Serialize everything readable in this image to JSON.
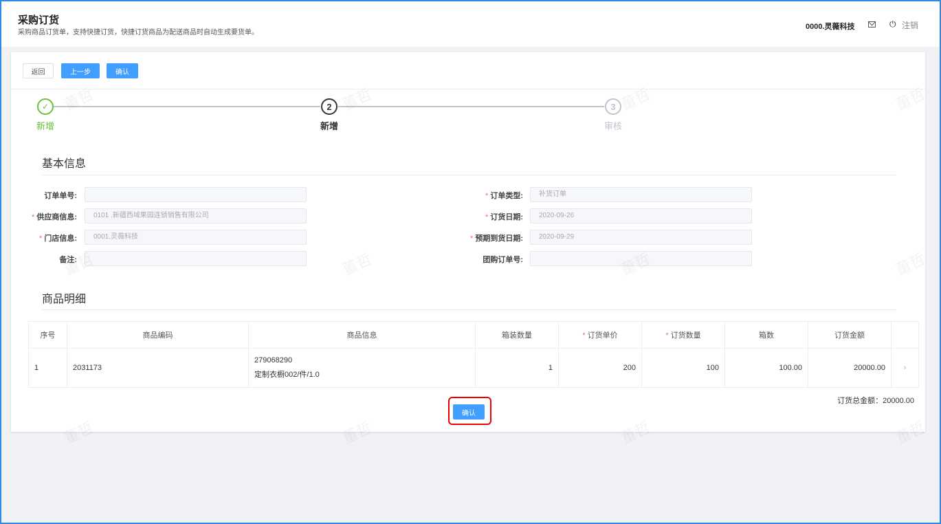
{
  "header": {
    "title": "采购订货",
    "subtitle": "采购商品订货单，支持快捷订货，快捷订货商品为配送商品时自动生成要货单。",
    "user": "0000.灵薇科技",
    "logout": "注销"
  },
  "toolbar": {
    "back": "返回",
    "prev": "上一步",
    "confirm": "确认"
  },
  "steps": [
    {
      "num": "✓",
      "label": "新增"
    },
    {
      "num": "2",
      "label": "新增"
    },
    {
      "num": "3",
      "label": "审核"
    }
  ],
  "basic": {
    "title": "基本信息",
    "order_no_label": "订单单号:",
    "order_no": "",
    "supplier_label": "供应商信息:",
    "supplier": "0101 .新疆西域果园连锁销售有限公司",
    "store_label": "门店信息:",
    "store": "0001.灵薇科技",
    "remark_label": "备注:",
    "remark": "",
    "type_label": "订单类型:",
    "type": "补货订单",
    "date_label": "订货日期:",
    "date": "2020-09-26",
    "expect_label": "预期到货日期:",
    "expect": "2020-09-29",
    "group_label": "团购订单号:",
    "group": ""
  },
  "detail": {
    "title": "商品明细",
    "columns": [
      "序号",
      "商品编码",
      "商品信息",
      "箱装数量",
      "订货单价",
      "订货数量",
      "箱数",
      "订货金额"
    ],
    "rows": [
      {
        "idx": "1",
        "code": "2031173",
        "info1": "279068290",
        "info2": "定制衣橱002/件/1.0",
        "pack": "1",
        "price": "200",
        "qty": "100",
        "boxes": "100.00",
        "amount": "20000.00"
      }
    ],
    "total": "订货总金额：20000.00"
  },
  "confirm_bottom": "确认",
  "watermark": "董哲",
  "colors": {
    "primary": "#409eff",
    "success": "#67c23a",
    "required": "#f56c6c"
  }
}
